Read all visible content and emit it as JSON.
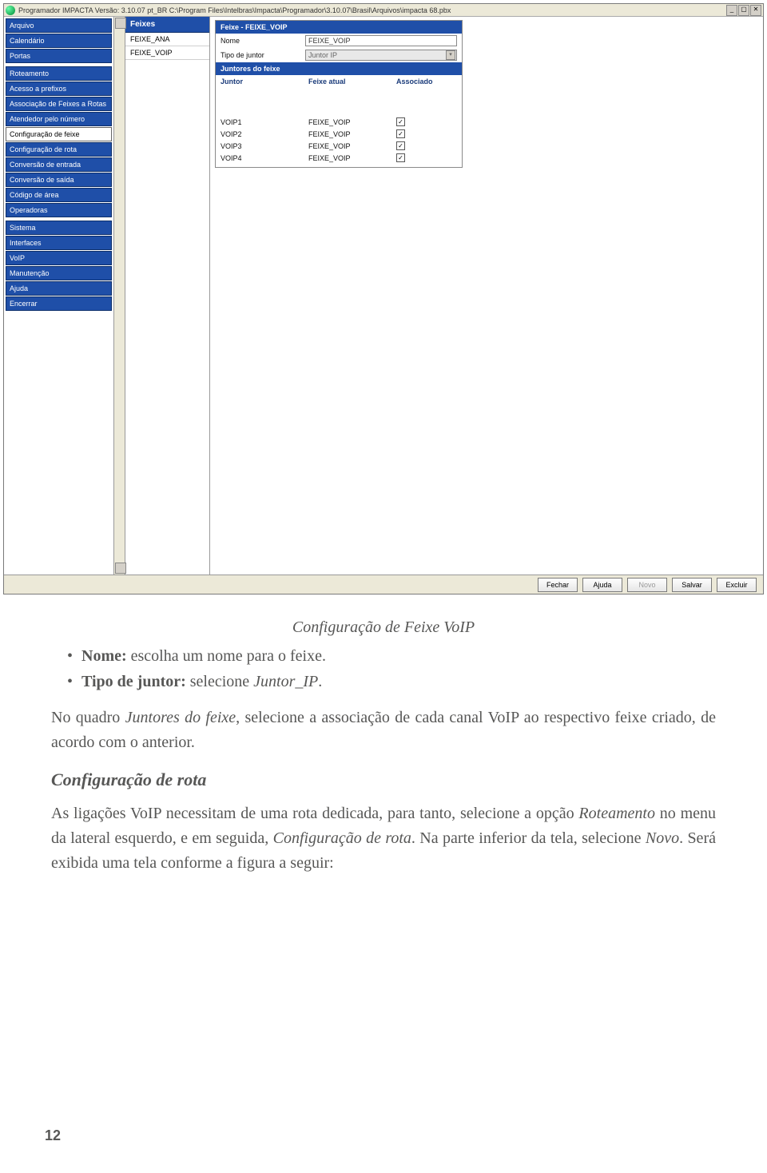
{
  "window": {
    "title": "Programador IMPACTA   Versão: 3.10.07 pt_BR   C:\\Program Files\\Intelbras\\Impacta\\Programador\\3.10.07\\Brasil\\Arquivos\\impacta 68.pbx",
    "controls": {
      "min": "_",
      "max": "▢",
      "close": "✕"
    }
  },
  "left_nav": {
    "items": [
      "Arquivo",
      "Calendário",
      "Portas",
      "Roteamento",
      "Acesso a prefixos",
      "Associação de Feixes a Rotas",
      "Atendedor pelo número",
      "Configuração de feixe",
      "Configuração de rota",
      "Conversão de entrada",
      "Conversão de saída",
      "Código de área",
      "Operadoras",
      "Sistema",
      "Interfaces",
      "VoIP",
      "Manutenção",
      "Ajuda",
      "Encerrar"
    ],
    "selected_index": 7,
    "gap_after": [
      2,
      12
    ]
  },
  "mid": {
    "header": "Feixes",
    "items": [
      "FEIXE_ANA",
      "FEIXE_VOIP"
    ]
  },
  "right": {
    "panel_title": "Feixe - FEIXE_VOIP",
    "name_label": "Nome",
    "name_value": "FEIXE_VOIP",
    "tipo_label": "Tipo de juntor",
    "tipo_value": "Juntor IP",
    "sub_header": "Juntores do feixe",
    "cols": {
      "c1": "Juntor",
      "c2": "Feixe atual",
      "c3": "Associado"
    },
    "rows": [
      {
        "juntor": "VOIP1",
        "feixe": "FEIXE_VOIP",
        "assoc": true
      },
      {
        "juntor": "VOIP2",
        "feixe": "FEIXE_VOIP",
        "assoc": true
      },
      {
        "juntor": "VOIP3",
        "feixe": "FEIXE_VOIP",
        "assoc": true
      },
      {
        "juntor": "VOIP4",
        "feixe": "FEIXE_VOIP",
        "assoc": true
      }
    ]
  },
  "buttons": {
    "fechar": "Fechar",
    "ajuda": "Ajuda",
    "novo": "Novo",
    "salvar": "Salvar",
    "excluir": "Excluir"
  },
  "doc": {
    "caption": "Configuração de Feixe VoIP",
    "bullet_nome_label": "Nome:",
    "bullet_nome_text": " escolha um nome para o feixe.",
    "bullet_tipo_label": "Tipo de juntor:",
    "bullet_tipo_text_a": " selecione ",
    "bullet_tipo_text_b": "Juntor_IP",
    "para1_a": "No quadro ",
    "para1_b": "Juntores do feixe",
    "para1_c": ", selecione a associação de cada canal VoIP ao respectivo feixe criado, de acordo com o anterior.",
    "subhead": "Configuração de rota",
    "para2_a": "As ligações VoIP necessitam de uma rota dedicada, para tanto, selecione a opção ",
    "para2_b": "Roteamento",
    "para2_c": " no menu da lateral esquerdo, e em seguida, ",
    "para2_d": "Configuração de rota",
    "para2_e": ". Na parte inferior da tela, selecione ",
    "para2_f": "Novo",
    "para2_g": ". Será exibida uma tela conforme a figura a seguir:",
    "page": "12"
  }
}
